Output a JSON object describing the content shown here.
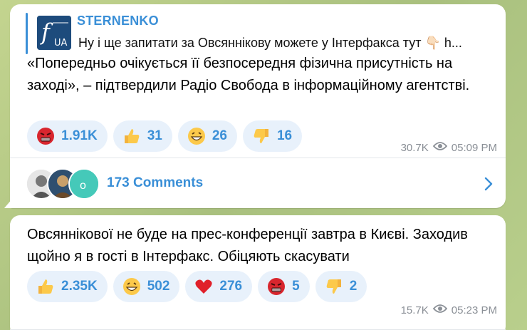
{
  "colors": {
    "accent": "#3a8fd7",
    "reaction_bg": "#e8f1fb",
    "meta": "#8a8f96"
  },
  "post1": {
    "author": "STERNENKO",
    "reply_preview": "Ну і ще запитати за Овсяннікову можете у Інтерфакса тут 👇🏻 h...",
    "body": "«Попередньо очікується її безпосередня фізична присутність на заході», – підтвердили Радіо Свобода в інформаційному агентстві.",
    "reactions": [
      {
        "icon": "angry-face-icon",
        "count": "1.91K"
      },
      {
        "icon": "thumbs-up-icon",
        "count": "31"
      },
      {
        "icon": "grinning-face-icon",
        "count": "26"
      },
      {
        "icon": "thumbs-down-icon",
        "count": "16"
      }
    ],
    "views": "30.7K",
    "time": "05:09 PM",
    "comments_label": "173 Comments"
  },
  "post2": {
    "body": "Овсяннікової не буде на прес-конференції завтра в Києві. Заходив щойно я в гості в Інтерфакс. Обіцяють скасувати",
    "reactions": [
      {
        "icon": "thumbs-up-icon",
        "count": "2.35K"
      },
      {
        "icon": "grinning-face-icon",
        "count": "502"
      },
      {
        "icon": "red-heart-icon",
        "count": "276"
      },
      {
        "icon": "angry-face-icon",
        "count": "5"
      },
      {
        "icon": "thumbs-down-icon",
        "count": "2"
      }
    ],
    "views": "15.7K",
    "time": "05:23 PM"
  }
}
